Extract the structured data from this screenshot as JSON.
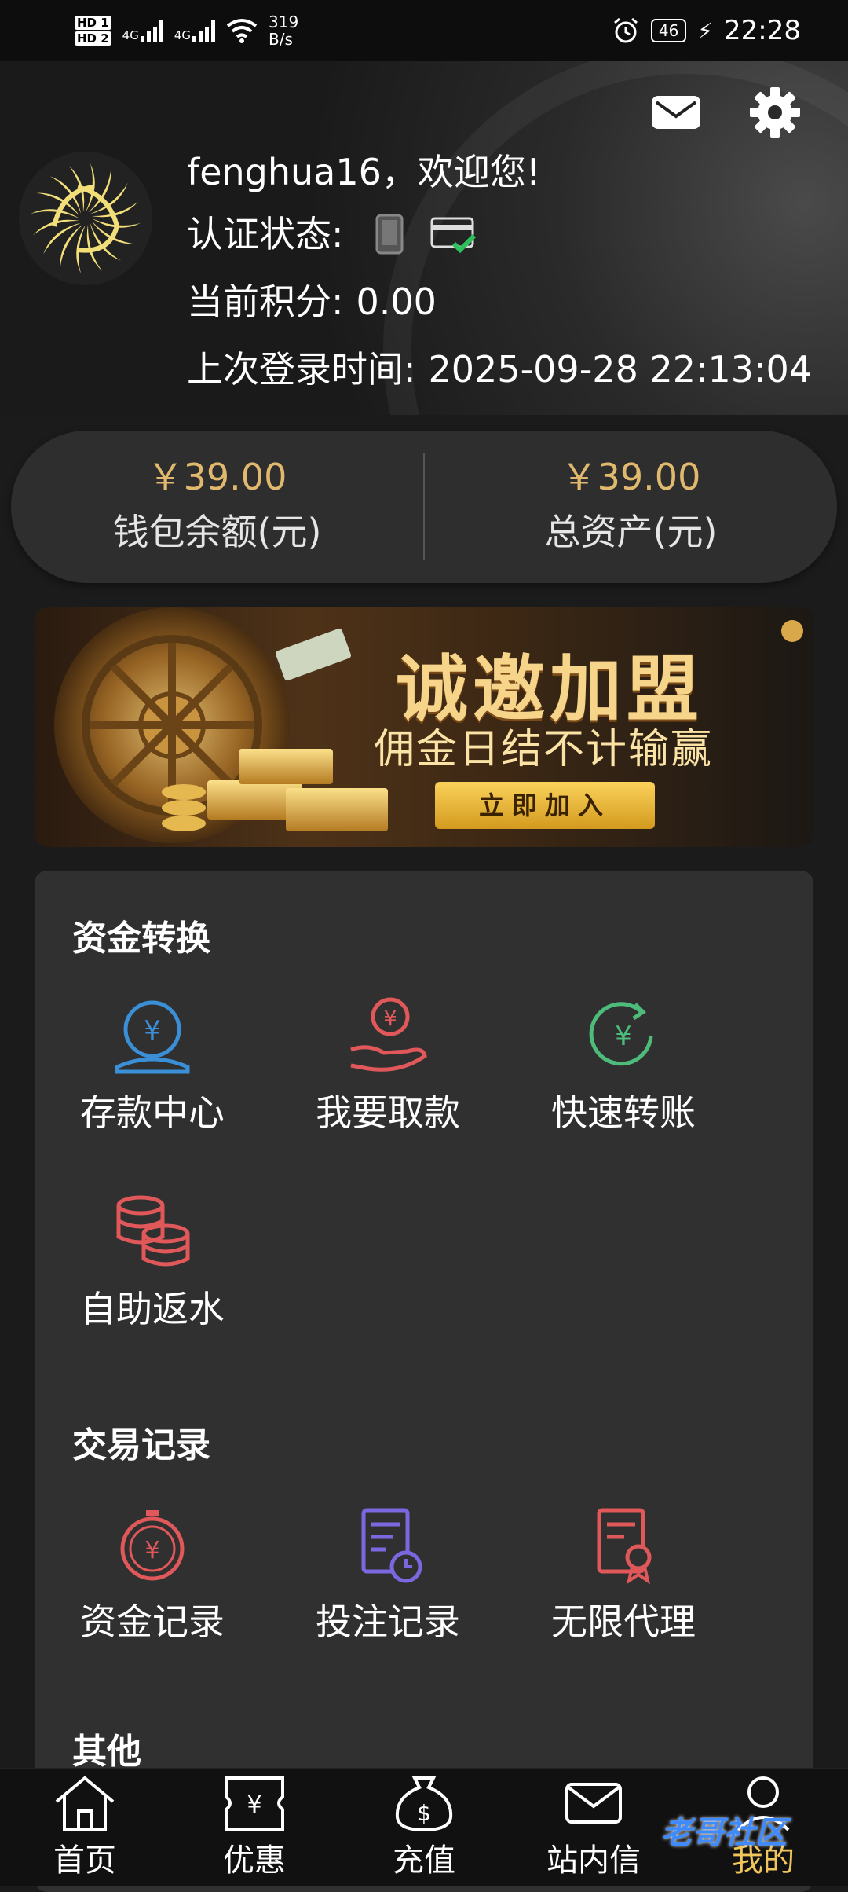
{
  "status_bar": {
    "sim1": "HD 1",
    "sim2": "HD 2",
    "net1": "4G",
    "net2": "4G",
    "speed_value": "319",
    "speed_unit": "B/s",
    "battery": "46",
    "time": "22:28"
  },
  "user": {
    "greeting": "fenghua16，欢迎您!",
    "auth_label": "认证状态:",
    "points_label": "当前积分:",
    "points_value": "0.00",
    "last_login_label": "上次登录时间:",
    "last_login_value": "2025-09-28 22:13:04"
  },
  "balance": {
    "wallet_amount": "￥39.00",
    "wallet_label": "钱包余额(元)",
    "total_amount": "￥39.00",
    "total_label": "总资产(元)"
  },
  "banner": {
    "title": "诚邀加盟",
    "subtitle": "佣金日结不计输赢",
    "button": "立即加入"
  },
  "sections": {
    "funds_title": "资金转换",
    "funds": [
      "存款中心",
      "我要取款",
      "快速转账",
      "自助返水"
    ],
    "records_title": "交易记录",
    "records": [
      "资金记录",
      "投注记录",
      "无限代理"
    ],
    "other_title": "其他"
  },
  "tabbar": [
    "首页",
    "优惠",
    "充值",
    "站内信",
    "我的"
  ],
  "watermark": "老哥社区",
  "colors": {
    "gold": "#e0b86e",
    "blue_icon": "#3b8fd6",
    "red_icon": "#e0585a",
    "green_icon": "#4dbb7a",
    "purple_icon": "#7b68e0"
  }
}
